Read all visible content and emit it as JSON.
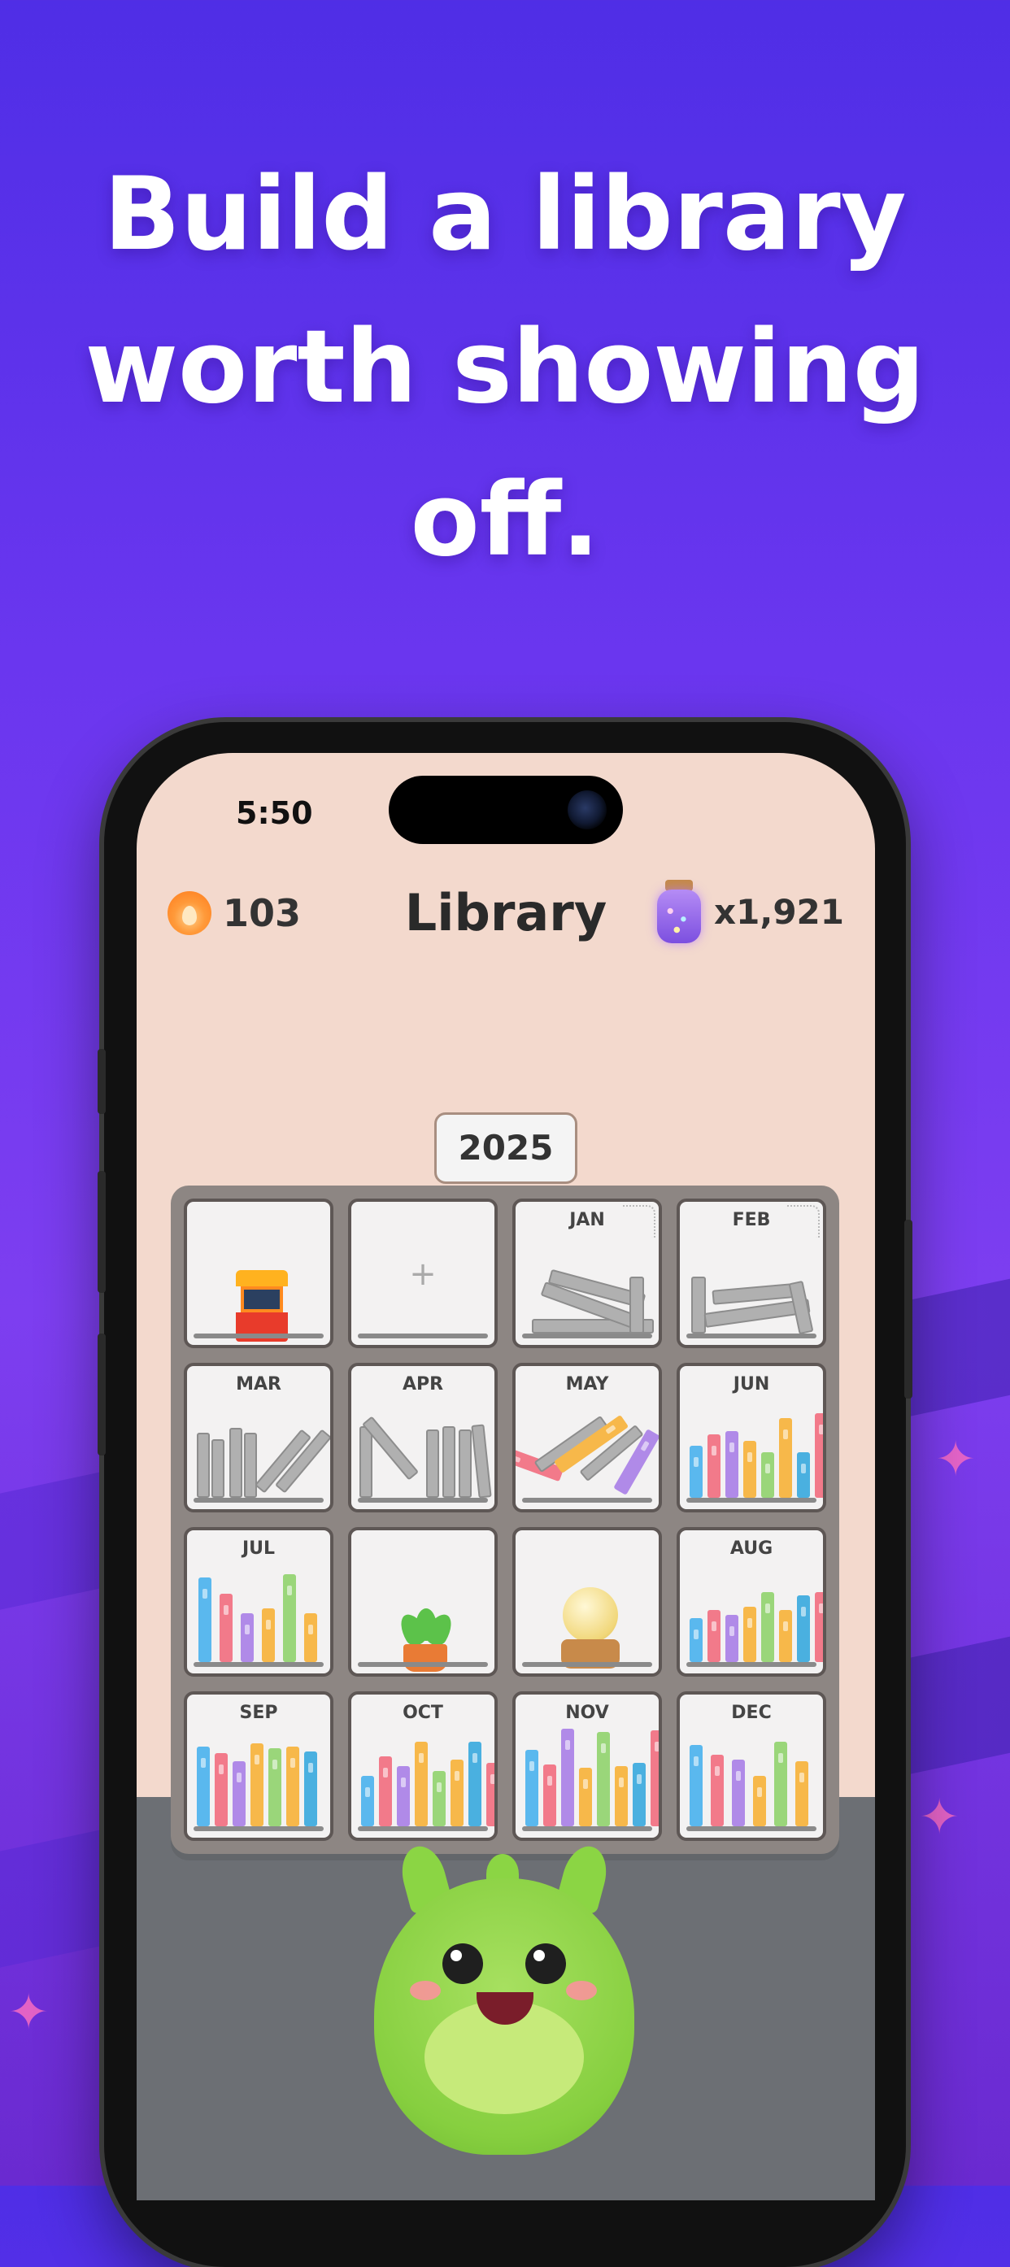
{
  "headline": [
    "Build a library",
    "worth showing",
    "off."
  ],
  "status_bar": {
    "time": "5:50"
  },
  "header": {
    "streak_count": "103",
    "title": "Library",
    "gem_count": "x1,921"
  },
  "year_selector": {
    "label": "2025"
  },
  "shelf_cells": [
    {
      "type": "decoration",
      "icon": "arcade-machine-icon"
    },
    {
      "type": "add",
      "label": "+"
    },
    {
      "type": "month",
      "label": "JAN",
      "state": "empty-dusty"
    },
    {
      "type": "month",
      "label": "FEB",
      "state": "empty-dusty"
    },
    {
      "type": "month",
      "label": "MAR",
      "state": "gray"
    },
    {
      "type": "month",
      "label": "APR",
      "state": "gray"
    },
    {
      "type": "month",
      "label": "MAY",
      "state": "mixed"
    },
    {
      "type": "month",
      "label": "JUN",
      "state": "colored"
    },
    {
      "type": "month",
      "label": "JUL",
      "state": "colored"
    },
    {
      "type": "decoration",
      "icon": "potted-plant-icon"
    },
    {
      "type": "decoration",
      "icon": "crystal-ball-icon"
    },
    {
      "type": "month",
      "label": "AUG",
      "state": "colored"
    },
    {
      "type": "month",
      "label": "SEP",
      "state": "colored"
    },
    {
      "type": "month",
      "label": "OCT",
      "state": "colored"
    },
    {
      "type": "month",
      "label": "NOV",
      "state": "colored"
    },
    {
      "type": "month",
      "label": "DEC",
      "state": "colored"
    }
  ],
  "colors": {
    "background": "#6a36ef",
    "screen_bg": "#f3d9cd",
    "shelf_frame": "#8d8683",
    "floor": "#6c6f74",
    "book_palette": [
      "#5ab8ee",
      "#f27a8a",
      "#b08ae8",
      "#f7b84a",
      "#9ad67a",
      "#4ab0e0"
    ]
  }
}
